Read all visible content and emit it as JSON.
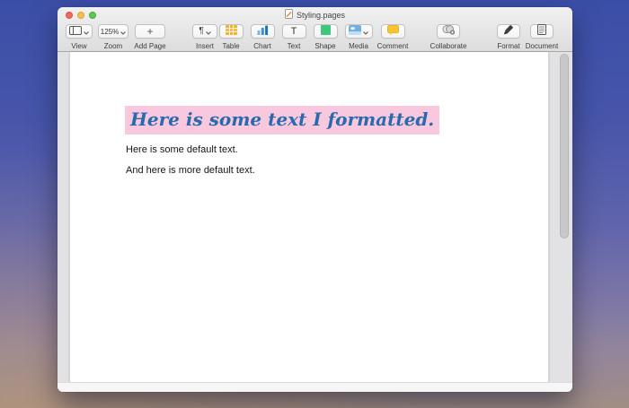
{
  "titlebar": {
    "title": "Styling.pages"
  },
  "toolbar": {
    "items": [
      {
        "label": "View",
        "icon": "panel-layout-icon",
        "has_chevron": true
      },
      {
        "label": "Zoom",
        "value": "125%",
        "has_chevron": true
      },
      {
        "label": "Add Page",
        "icon": "plus-icon",
        "glyph": "+"
      },
      {
        "label": "Insert",
        "icon": "paragraph-icon",
        "glyph": "¶",
        "has_chevron": true
      },
      {
        "label": "Table",
        "icon": "table-icon"
      },
      {
        "label": "Chart",
        "icon": "bar-chart-icon"
      },
      {
        "label": "Text",
        "icon": "text-icon",
        "glyph": "T"
      },
      {
        "label": "Shape",
        "icon": "shape-icon"
      },
      {
        "label": "Media",
        "icon": "media-icon",
        "has_chevron": true
      },
      {
        "label": "Comment",
        "icon": "comment-icon"
      },
      {
        "label": "Collaborate",
        "icon": "collaborate-icon"
      },
      {
        "label": "Format",
        "icon": "format-brush-icon"
      },
      {
        "label": "Document",
        "icon": "document-icon"
      }
    ]
  },
  "document": {
    "formatted_text": "Here is some text I formatted.",
    "highlight_color": "#f8c8de",
    "formatted_text_color": "#2b69ad",
    "paragraphs": [
      "Here is some default text.",
      "And here is more default text."
    ]
  },
  "colors": {
    "desktop_top": "#3b4ea7",
    "desktop_bottom": "#a08e85",
    "table_icon": "#f2b32c",
    "chart_icon": "#2f7ac2",
    "shape_icon": "#3fc77d",
    "comment_icon": "#f8c62a"
  }
}
